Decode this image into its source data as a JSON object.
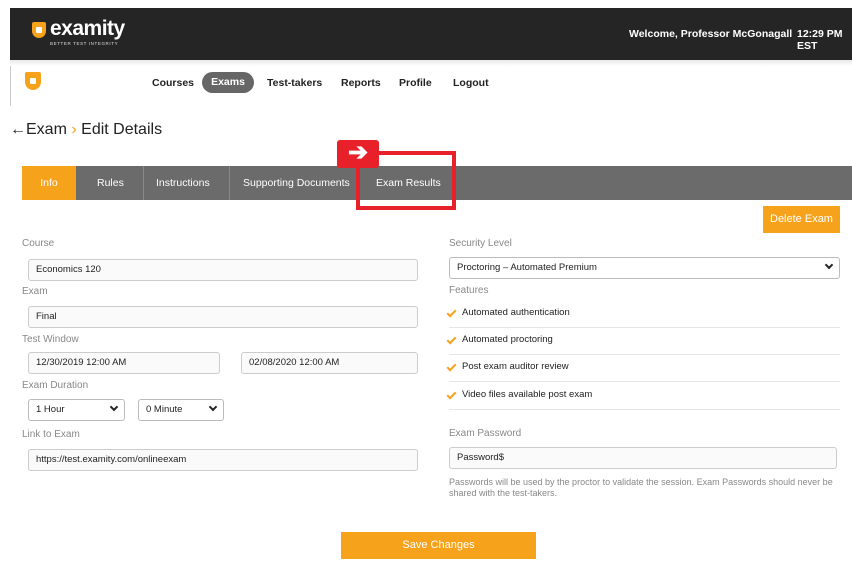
{
  "header": {
    "logo_word": "examity",
    "logo_tagline": "BETTER TEST INTEGRITY",
    "welcome": "Welcome, Professor McGonagall",
    "time": "12:29 PM  EST"
  },
  "nav": {
    "items": [
      "Courses",
      "Exams",
      "Test-takers",
      "Reports",
      "Profile",
      "Logout"
    ],
    "active": "Exams"
  },
  "page": {
    "back_label": "Exam",
    "separator": "›",
    "title": "Edit Details"
  },
  "tabs": [
    "Info",
    "Rules",
    "Instructions",
    "Supporting Documents",
    "Exam Results"
  ],
  "active_tab": "Info",
  "buttons": {
    "delete": "Delete Exam",
    "save": "Save Changes"
  },
  "form": {
    "course_label": "Course",
    "course_value": "Economics 120",
    "exam_label": "Exam",
    "exam_value": "Final",
    "window_label": "Test Window",
    "window_start": "12/30/2019 12:00 AM",
    "window_end": "02/08/2020 12:00 AM",
    "duration_label": "Exam Duration",
    "duration_hours": "1 Hour",
    "duration_minutes": "0 Minute",
    "link_label": "Link to Exam",
    "link_value": "https://test.examity.com/onlineexam",
    "security_label": "Security Level",
    "security_value": "Proctoring – Automated Premium",
    "features_label": "Features",
    "features": [
      "Automated authentication",
      "Automated proctoring",
      "Post exam auditor review",
      "Video files available post exam"
    ],
    "password_label": "Exam Password",
    "password_value": "Password$",
    "password_note": "Passwords will be used by the proctor to validate the session. Exam Passwords should never be shared with the test-takers."
  },
  "colors": {
    "accent": "#f7a21b",
    "header_bg": "#252525",
    "tab_bg": "#6b6b6b",
    "annotation": "#e8202a"
  },
  "icons": {
    "logo": "shield-lock-icon",
    "annotation": "right-arrow-icon",
    "feature": "checkmark-icon",
    "select": "chevron-down-icon",
    "back": "left-arrow-icon"
  }
}
